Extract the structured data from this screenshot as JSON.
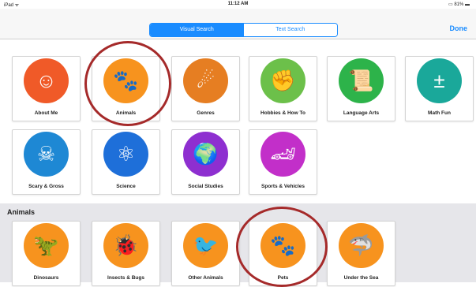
{
  "status": {
    "left": "iPad ᯤ",
    "time": "11:12 AM",
    "battery": "▭ 81% ▬"
  },
  "nav": {
    "seg_left": "Visual Search",
    "seg_right": "Text Search",
    "done": "Done"
  },
  "section_title": "Animals",
  "row1": [
    {
      "label": "About Me",
      "color": "#f05a28",
      "icon": "☺"
    },
    {
      "label": "Animals",
      "color": "#f7931e",
      "icon": "🐾"
    },
    {
      "label": "Genres",
      "color": "#e67e22",
      "icon": "☄"
    },
    {
      "label": "Hobbies & How To",
      "color": "#6cc04a",
      "icon": "✊"
    },
    {
      "label": "Language Arts",
      "color": "#2db34a",
      "icon": "📜"
    },
    {
      "label": "Math Fun",
      "color": "#1aa89a",
      "icon": "±"
    }
  ],
  "row2": [
    {
      "label": "Scary & Gross",
      "color": "#1e88d4",
      "icon": "☠"
    },
    {
      "label": "Science",
      "color": "#1e6fd9",
      "icon": "⚛"
    },
    {
      "label": "Social Studies",
      "color": "#8e2fd0",
      "icon": "🌍"
    },
    {
      "label": "Sports & Vehicles",
      "color": "#c22fc9",
      "icon": "🏎"
    }
  ],
  "row3": [
    {
      "label": "Dinosaurs",
      "color": "#f7931e",
      "icon": "🦖"
    },
    {
      "label": "Insects & Bugs",
      "color": "#f7931e",
      "icon": "🐞"
    },
    {
      "label": "Other Animals",
      "color": "#f7931e",
      "icon": "🐦"
    },
    {
      "label": "Pets",
      "color": "#f7931e",
      "icon": "🐾"
    },
    {
      "label": "Under the Sea",
      "color": "#f7931e",
      "icon": "🦈"
    }
  ]
}
